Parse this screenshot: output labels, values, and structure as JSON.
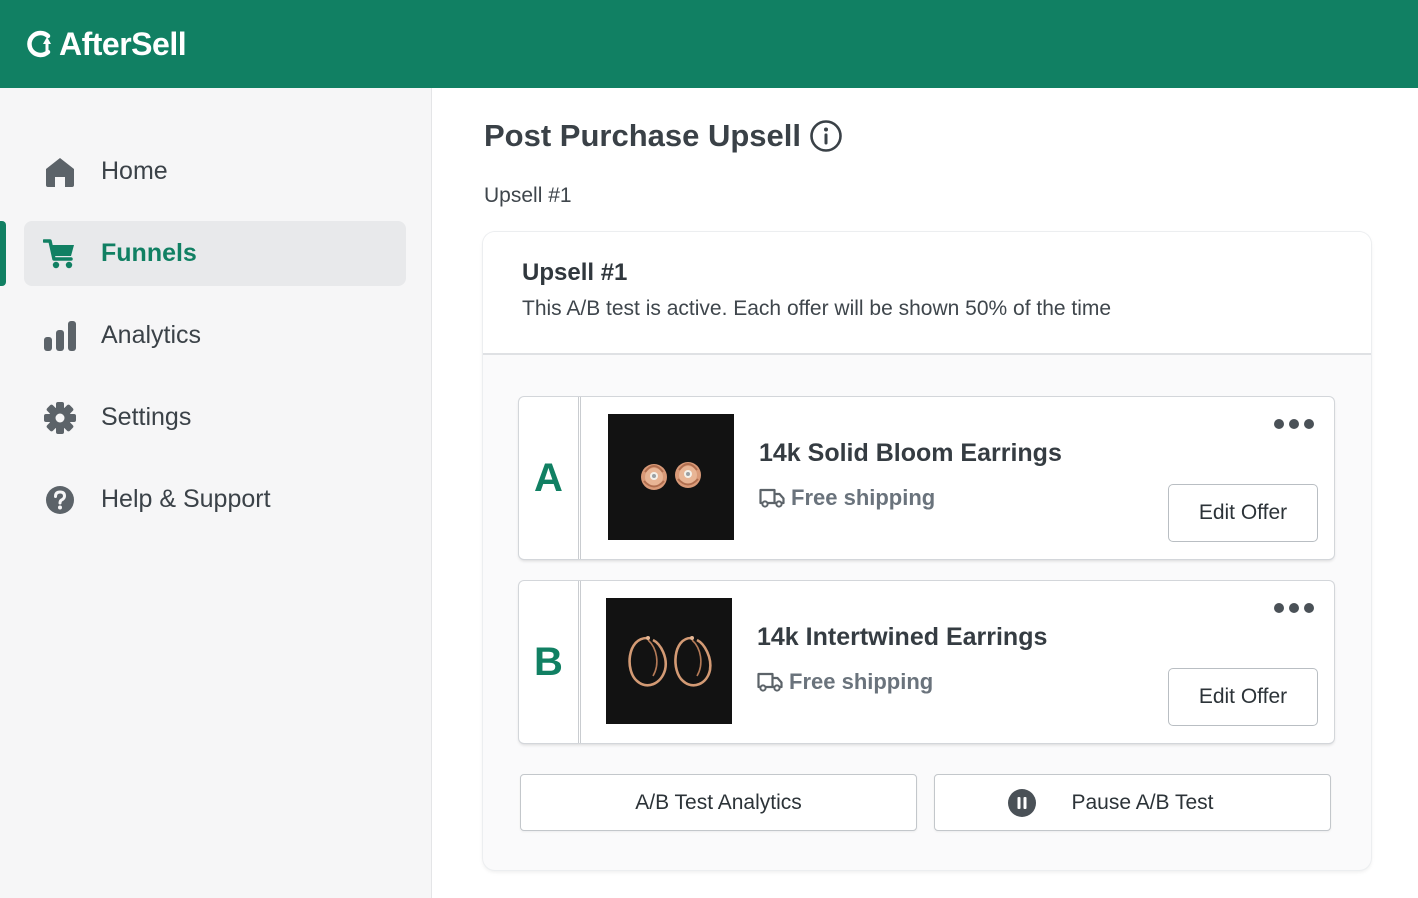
{
  "app": {
    "name": "AfterSell"
  },
  "colors": {
    "brand": "#118063",
    "sidebar_bg": "#f6f6f7"
  },
  "sidebar": {
    "items": [
      {
        "label": "Home",
        "icon": "home-icon"
      },
      {
        "label": "Funnels",
        "icon": "cart-icon",
        "active": true
      },
      {
        "label": "Analytics",
        "icon": "bar-chart-icon"
      },
      {
        "label": "Settings",
        "icon": "gear-icon"
      },
      {
        "label": "Help & Support",
        "icon": "help-icon"
      }
    ]
  },
  "page": {
    "title": "Post Purchase Upsell",
    "breadcrumb": "Upsell #1"
  },
  "upsell": {
    "title": "Upsell #1",
    "description": "This A/B test is active. Each offer will be shown 50% of the time",
    "offers": [
      {
        "letter": "A",
        "name": "14k Solid Bloom Earrings",
        "shipping": "Free shipping",
        "edit_label": "Edit Offer"
      },
      {
        "letter": "B",
        "name": "14k Intertwined Earrings",
        "shipping": "Free shipping",
        "edit_label": "Edit Offer"
      }
    ],
    "analytics_label": "A/B Test Analytics",
    "pause_label": "Pause A/B Test"
  }
}
